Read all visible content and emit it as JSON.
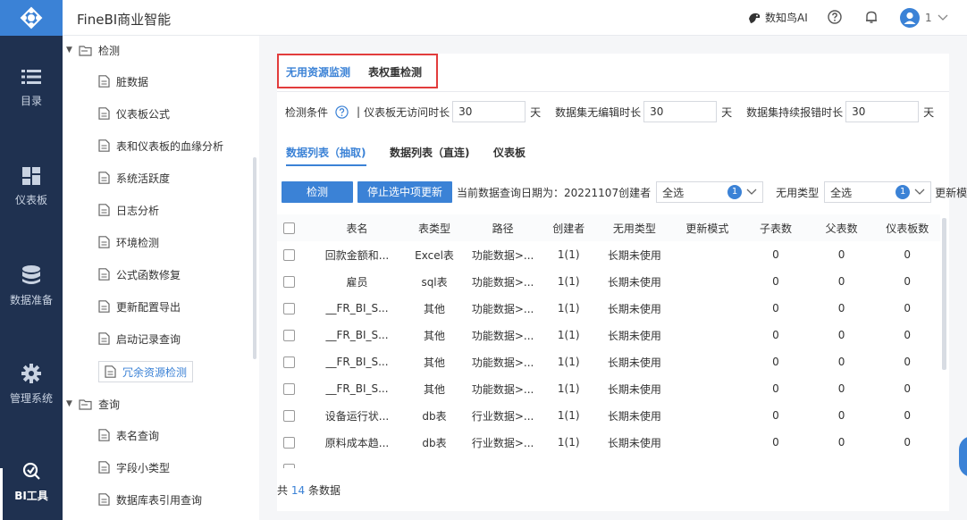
{
  "app": {
    "title": "FineBI商业智能"
  },
  "topbar": {
    "ai_label": "数知鸟AI",
    "user_label": "1"
  },
  "nav": {
    "items": [
      {
        "label": "目录",
        "icon": "list-icon"
      },
      {
        "label": "仪表板",
        "icon": "dashboard-icon"
      },
      {
        "label": "数据准备",
        "icon": "database-icon"
      },
      {
        "label": "管理系统",
        "icon": "gear-icon"
      },
      {
        "label": "BI工具",
        "icon": "bi-tool-icon"
      }
    ]
  },
  "tree": {
    "groups": [
      {
        "label": "检测"
      },
      {
        "label": "查询"
      }
    ],
    "items": [
      {
        "label": "脏数据"
      },
      {
        "label": "仪表板公式"
      },
      {
        "label": "表和仪表板的血缘分析"
      },
      {
        "label": "系统活跃度"
      },
      {
        "label": "日志分析"
      },
      {
        "label": "环境检测"
      },
      {
        "label": "公式函数修复"
      },
      {
        "label": "更新配置导出"
      },
      {
        "label": "启动记录查询"
      },
      {
        "label": "冗余资源检测"
      },
      {
        "label": "表名查询"
      },
      {
        "label": "字段小类型"
      },
      {
        "label": "数据库表引用查询"
      }
    ]
  },
  "main": {
    "tabs": [
      {
        "label": "无用资源监测"
      },
      {
        "label": "表权重检测"
      }
    ],
    "condition": {
      "label": "检测条件",
      "sep": "|",
      "f1_label": "仪表板无访问时长",
      "f1_value": "30",
      "f1_unit": "天",
      "f2_label": "数据集无编辑时长",
      "f2_value": "30",
      "f2_unit": "天",
      "f3_label": "数据集持续报错时长",
      "f3_value": "30",
      "f3_unit": "天"
    },
    "subtabs": [
      {
        "label": "数据列表（抽取)"
      },
      {
        "label": "数据列表（直连)"
      },
      {
        "label": "仪表板"
      }
    ],
    "buttons": {
      "check": "检测",
      "stop": "停止选中项更新"
    },
    "filters": {
      "date_text": "当前数据查询日期为：20221107",
      "creator_label": "创建者",
      "creator_value": "全选",
      "creator_count": "1",
      "type_label": "无用类型",
      "type_value": "全选",
      "type_count": "1",
      "update_label": "更新模式"
    },
    "columns": [
      "表名",
      "表类型",
      "路径",
      "创建者",
      "无用类型",
      "更新模式",
      "子表数",
      "父表数",
      "仪表板数"
    ],
    "rows": [
      [
        "回款金额和...",
        "Excel表",
        "功能数据>...",
        "1(1)",
        "长期未使用",
        "",
        "0",
        "0",
        "0"
      ],
      [
        "雇员",
        "sql表",
        "功能数据>...",
        "1(1)",
        "长期未使用",
        "",
        "0",
        "0",
        "0"
      ],
      [
        "__FR_BI_S...",
        "其他",
        "功能数据>...",
        "1(1)",
        "长期未使用",
        "",
        "0",
        "0",
        "0"
      ],
      [
        "__FR_BI_S...",
        "其他",
        "功能数据>...",
        "1(1)",
        "长期未使用",
        "",
        "0",
        "0",
        "0"
      ],
      [
        "__FR_BI_S...",
        "其他",
        "功能数据>...",
        "1(1)",
        "长期未使用",
        "",
        "0",
        "0",
        "0"
      ],
      [
        "__FR_BI_S...",
        "其他",
        "功能数据>...",
        "1(1)",
        "长期未使用",
        "",
        "0",
        "0",
        "0"
      ],
      [
        "设备运行状...",
        "db表",
        "行业数据>...",
        "1(1)",
        "长期未使用",
        "",
        "0",
        "0",
        "0"
      ],
      [
        "原料成本趋...",
        "db表",
        "行业数据>...",
        "1(1)",
        "长期未使用",
        "",
        "0",
        "0",
        "0"
      ]
    ],
    "footer": {
      "prefix": "共",
      "count": "14",
      "suffix": "条数据"
    }
  },
  "colors": {
    "nav_bg": "#1f3150",
    "accent": "#3b82d6",
    "highlight": "#e23c3c"
  }
}
